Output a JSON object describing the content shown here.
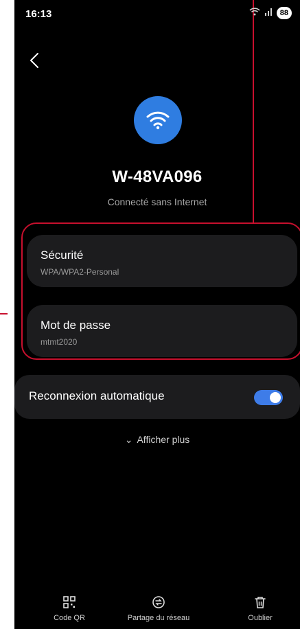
{
  "status_bar": {
    "time": "16:13",
    "battery": "88"
  },
  "network": {
    "ssid": "W-48VA096",
    "status": "Connecté sans Internet"
  },
  "security": {
    "title": "Sécurité",
    "value": "WPA/WPA2-Personal"
  },
  "password": {
    "title": "Mot de passe",
    "value": "mtmt2020"
  },
  "auto_reconnect": {
    "label": "Reconnexion automatique",
    "enabled": true
  },
  "show_more": "Afficher plus",
  "bottom_bar": {
    "qr": "Code QR",
    "share": "Partage du réseau",
    "forget": "Oublier"
  },
  "colors": {
    "accent": "#2f7de1",
    "toggle_on": "#3e7ce8",
    "highlight": "#c8102e",
    "card_bg": "#1c1c1e"
  }
}
